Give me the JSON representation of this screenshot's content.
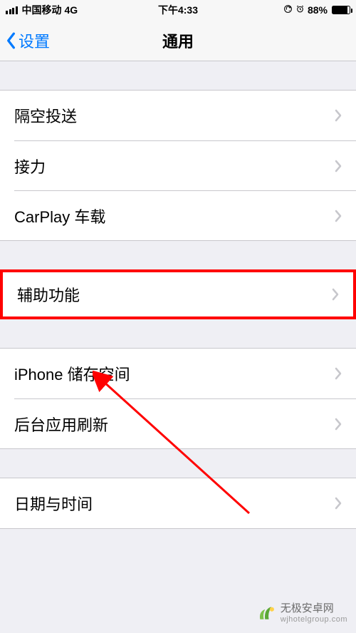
{
  "status": {
    "carrier": "中国移动",
    "network": "4G",
    "time": "下午4:33",
    "battery_pct": "88%"
  },
  "nav": {
    "back_label": "设置",
    "title": "通用"
  },
  "groups": [
    {
      "rows": [
        {
          "label": "隔空投送"
        },
        {
          "label": "接力"
        },
        {
          "label": "CarPlay 车载"
        }
      ]
    },
    {
      "rows": [
        {
          "label": "辅助功能"
        }
      ],
      "highlighted": true
    },
    {
      "rows": [
        {
          "label": "iPhone 储存空间"
        },
        {
          "label": "后台应用刷新"
        }
      ]
    },
    {
      "rows": [
        {
          "label": "日期与时间"
        }
      ]
    }
  ],
  "watermark": {
    "title": "无极安卓网",
    "url": "wjhotelgroup.com"
  },
  "colors": {
    "accent": "#007aff",
    "highlight": "#ff0000"
  }
}
